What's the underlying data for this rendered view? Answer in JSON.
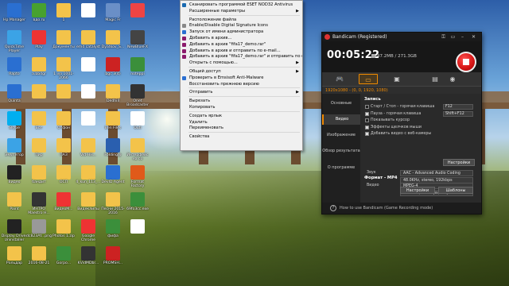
{
  "desktop": {
    "icons": [
      {
        "label": "Hp Manager",
        "color": "#2a6fd1"
      },
      {
        "label": "вдо.ru",
        "color": "#47a12f"
      },
      {
        "label": "1",
        "color": "#f3c34a"
      },
      {
        "label": "",
        "color": "#ffffff"
      },
      {
        "label": "Magic Fr",
        "color": "#6a8fc7"
      },
      {
        "label": "",
        "color": "#e44"
      },
      {
        "label": "QuickTime Player",
        "color": "#3ba3e6"
      },
      {
        "label": "Play",
        "color": "#e33"
      },
      {
        "label": "Документы",
        "color": "#f3c34a"
      },
      {
        "label": "emd catalyst",
        "color": "#f3c34a"
      },
      {
        "label": "Dyatkov_S...",
        "color": "#f3c34a"
      },
      {
        "label": "NewBlueFX",
        "color": "#444"
      },
      {
        "label": "Rapto",
        "color": "#2a6fd1"
      },
      {
        "label": "a.bbdgr",
        "color": "#f3c34a"
      },
      {
        "label": "1 iso 1001-2066",
        "color": "#f3c34a"
      },
      {
        "label": "",
        "color": "#fff"
      },
      {
        "label": "bgc 3(4)",
        "color": "#cc2222"
      },
      {
        "label": "noteppi",
        "color": "#3b8f3b"
      },
      {
        "label": "Quinta",
        "color": "#2a6fd1"
      },
      {
        "label": "",
        "color": "#f3c34a"
      },
      {
        "label": "",
        "color": "#f3c34a"
      },
      {
        "label": "",
        "color": "#fff"
      },
      {
        "label": "Dedhill",
        "color": "#f3c34a"
      },
      {
        "label": "Onet Broadcaster",
        "color": "#333"
      },
      {
        "label": "Skype",
        "color": "#00aff0"
      },
      {
        "label": "Бот",
        "color": "#f3c34a"
      },
      {
        "label": "Отфон",
        "color": "#f3c34a"
      },
      {
        "label": "",
        "color": "#fff"
      },
      {
        "label": "Ben Files",
        "color": "#f3c34a"
      },
      {
        "label": "Outl",
        "color": "#fff"
      },
      {
        "label": "Эмулятор",
        "color": "#3ba3e6"
      },
      {
        "label": "Пир",
        "color": "#f3c34a"
      },
      {
        "label": "ПАЗ",
        "color": "#f3c34a"
      },
      {
        "label": "Vid-HH...",
        "color": "#f3c34a"
      },
      {
        "label": "Folding@",
        "color": "#2a5faf"
      },
      {
        "label": "Интерфейс на со",
        "color": "#f3c34a"
      },
      {
        "label": "Видео",
        "color": "#222"
      },
      {
        "label": "бандит",
        "color": "#f3c34a"
      },
      {
        "label": "ОСП",
        "color": "#f3c34a"
      },
      {
        "label": "4_kun_113_...",
        "color": "#f3c34a"
      },
      {
        "label": "DevID Agent",
        "color": "#2a6fd1"
      },
      {
        "label": "Format Factory",
        "color": "#e05a1a"
      },
      {
        "label": "Paint",
        "color": "#f3c34a"
      },
      {
        "label": "ИНТРО Maestro H...",
        "color": "#333"
      },
      {
        "label": "ВидеоМ...",
        "color": "#e33"
      },
      {
        "label": "Видеклипы",
        "color": "#f3c34a"
      },
      {
        "label": "Песни 2015-2016",
        "color": "#f3c34a"
      },
      {
        "label": "69fo3cc.exe",
        "color": "#3b8f3b"
      },
      {
        "label": "Display Driver Uninstaller",
        "color": "#222"
      },
      {
        "label": "dc823AY...png",
        "color": "#999"
      },
      {
        "label": "Photos 1.zip",
        "color": "#f3c34a"
      },
      {
        "label": "Google Chrome",
        "color": "#e33"
      },
      {
        "label": "фифа",
        "color": "#3b8f3b"
      },
      {
        "label": "",
        "color": "#fff"
      },
      {
        "label": "Рольдар",
        "color": "#f3c34a"
      },
      {
        "label": "2016-08-21",
        "color": "#f3c34a"
      },
      {
        "label": "Gorpo...",
        "color": "#3b8f3b"
      },
      {
        "label": "KVidMDbr...",
        "color": "#333"
      },
      {
        "label": "PROMSH...",
        "color": "#cc2222"
      }
    ]
  },
  "context_menu": {
    "items": [
      {
        "label": "Сканировать программой ESET NOD32 Antivirus",
        "color": "#1a6ab0"
      },
      {
        "label": "Расширенные параметры",
        "arrow": true
      },
      {
        "sep": true
      },
      {
        "label": "Расположение файла"
      },
      {
        "label": "Enable/Disable Digital Signature Icons",
        "color": "#888"
      },
      {
        "label": "Запуск от имени администратора",
        "color": "#2a6fd1"
      },
      {
        "label": "Добавить в архив...",
        "color": "#8b1a6b"
      },
      {
        "label": "Добавить в архив \"fifa17_demo.rar\"",
        "color": "#8b1a6b"
      },
      {
        "label": "Добавить в архив и отправить по e-mail...",
        "color": "#8b1a6b"
      },
      {
        "label": "Добавить в архив \"fifa17_demo.rar\" и отправить по e-mail",
        "color": "#8b1a6b"
      },
      {
        "label": "Открыть с помощью...",
        "arrow": true
      },
      {
        "sep": true
      },
      {
        "label": "Общий доступ",
        "arrow": true
      },
      {
        "label": "Проверить в Emsisoft Anti-Malware",
        "color": "#2a6fd1"
      },
      {
        "label": "Восстановить прежнюю версию"
      },
      {
        "sep": true
      },
      {
        "label": "Отправить",
        "arrow": true
      },
      {
        "sep": true
      },
      {
        "label": "Вырезать"
      },
      {
        "label": "Копировать"
      },
      {
        "sep": true
      },
      {
        "label": "Создать ярлык"
      },
      {
        "label": "Удалить"
      },
      {
        "label": "Переименовать"
      },
      {
        "sep": true
      },
      {
        "label": "Свойства"
      }
    ]
  },
  "bandicam": {
    "title": "Bandicam (Registered)",
    "timer": "00:05:22",
    "file_size": "47.2MB / 271.3GB",
    "resolution": "1920x1080 - (0, 0, 1920, 1080)",
    "modes": [
      {
        "icon": "gamepad-icon",
        "glyph": "🎮",
        "active": false
      },
      {
        "icon": "rectangle-icon",
        "glyph": "▭",
        "active": true
      },
      {
        "icon": "device-icon",
        "glyph": "▣",
        "active": false
      }
    ],
    "sidebar": [
      {
        "label": "Основные",
        "active": false
      },
      {
        "label": "Видео",
        "active": true
      },
      {
        "label": "Изображение",
        "active": false
      },
      {
        "label": "Обзор результата",
        "active": false
      },
      {
        "label": "О программе",
        "active": false
      }
    ],
    "record_section": "Запись",
    "checkboxes": [
      {
        "label": "Старт / Стоп - горячая клавиша",
        "checked": true,
        "key": "F12"
      },
      {
        "label": "Пауза - горячая клавиша",
        "checked": false,
        "key": "Shift+F12"
      },
      {
        "label": "Показывать курсор",
        "checked": true
      },
      {
        "label": "Эффекты щелчков мыши",
        "checked": false
      },
      {
        "label": "Добавить видео с веб-камеры",
        "checked": false
      }
    ],
    "settings_button": "Настройки",
    "format_section": "Формат - MP4",
    "video_label": "Видео",
    "video_codec": "MPEG-4",
    "video_details": "Full Size, 30.00fps, 53q",
    "audio_label": "Звук",
    "audio_codec": "AAC - Advanced Audio Coding",
    "audio_details": "48.0KHz, stereo, 192kbps",
    "settings_button2": "Настройки",
    "templates_button": "Шаблоны",
    "status": "How to use Bandicam (Game Recording mode)"
  }
}
